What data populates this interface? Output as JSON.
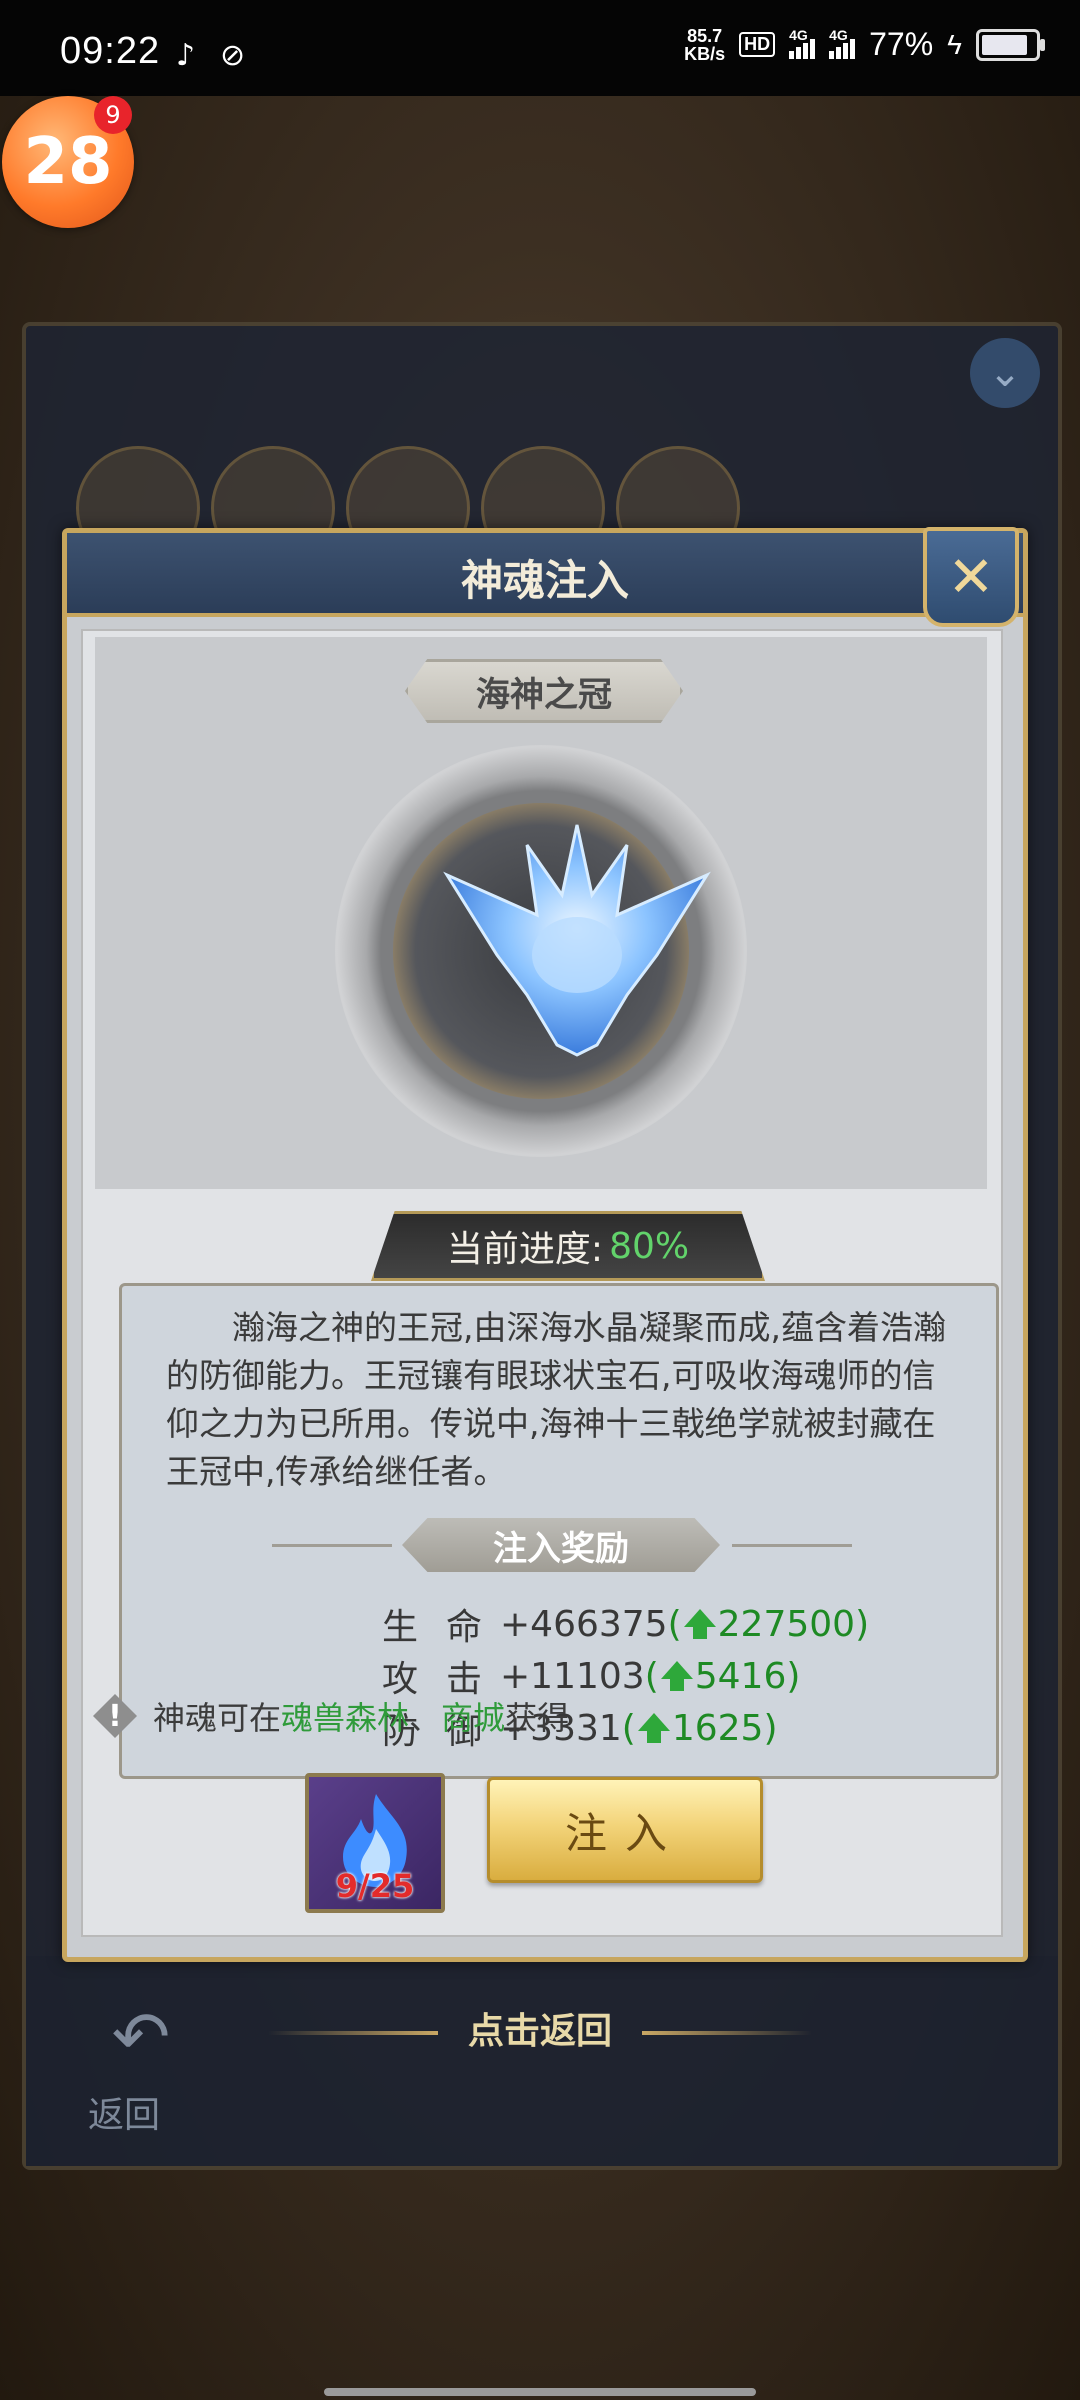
{
  "status_bar": {
    "time": "09:22",
    "net_speed_value": "85.7",
    "net_speed_unit": "KB/s",
    "hd_label": "HD",
    "sim1_label": "4G",
    "sim2_label": "4G",
    "battery_percent": "77%",
    "battery_level": 0.77
  },
  "floating_badge": {
    "label": "28",
    "count": "9"
  },
  "background_panel": {
    "footer_label": "返回"
  },
  "modal": {
    "title": "神魂注入",
    "item_name": "海神之冠",
    "progress_label": "当前进度:",
    "progress_value": "80%",
    "description": "瀚海之神的王冠,由深海水晶凝聚而成,蕴含着浩瀚的防御能力。王冠镶有眼球状宝石,可吸收海魂师的信仰之力为已所用。传说中,海神十三戟绝学就被封藏在王冠中,传承给继任者。",
    "reward_title": "注入奖励",
    "stats": [
      {
        "label": "生命",
        "value": "+466375",
        "open": "(",
        "bonus": "227500",
        "close": ")"
      },
      {
        "label": "攻击",
        "value": "+11103",
        "open": "(",
        "bonus": "5416",
        "close": ")"
      },
      {
        "label": "防御",
        "value": "+3331",
        "open": "(",
        "bonus": "1625",
        "close": ")"
      }
    ],
    "source_prefix": "神魂可在",
    "source_link1": "魂兽森林",
    "source_sep": "、",
    "source_link2": "商城",
    "source_suffix": "获得",
    "item_count": "9/25",
    "inject_button": "注入"
  },
  "back_prompt": "点击返回",
  "colors": {
    "accent_green": "#2f9b3a",
    "gold": "#c7a65e",
    "modal_header": "#2b3d58"
  }
}
